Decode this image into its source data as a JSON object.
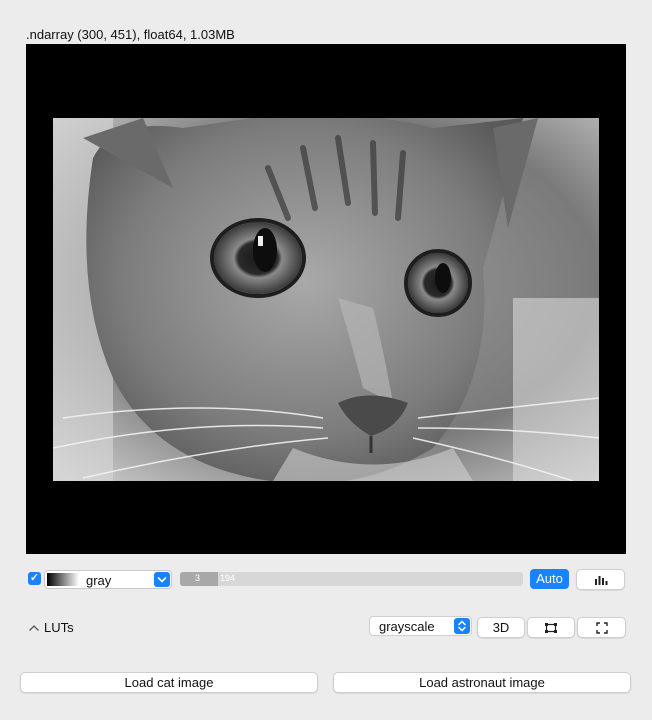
{
  "viewer": {
    "info_label": ".ndarray (300, 451), float64, 1.03MB"
  },
  "controls": {
    "visible_checked": true,
    "checkbox_glyph": "✓",
    "colormap": {
      "label": "gray",
      "chevron": "⌄"
    },
    "contrast": {
      "min_label": "3",
      "max_label": "194"
    },
    "auto_label": "Auto",
    "histogram_icon": "bar-chart-icon"
  },
  "luts": {
    "label": "LUTs",
    "caret": "︿",
    "mode": {
      "selected": "grayscale"
    },
    "btn_3d_label": "3D",
    "roi_icon": "roi-icon",
    "fullscreen_icon": "fullscreen-icon"
  },
  "actions": {
    "load_cat_label": "Load cat image",
    "load_astronaut_label": "Load astronaut image"
  },
  "colors": {
    "accent": "#1a82fb",
    "background": "#ececec",
    "canvas": "#000000"
  }
}
